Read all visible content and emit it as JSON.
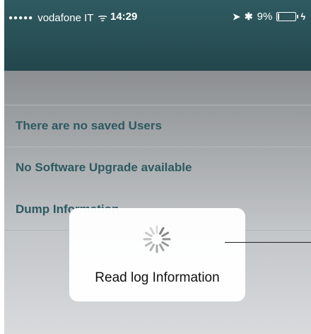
{
  "status_bar": {
    "signal": "●●●●●",
    "carrier": "vodafone IT",
    "wifi": "ᯤ",
    "time": "14:29",
    "location_icon": "➤",
    "bluetooth_icon": "✱",
    "battery": "9%",
    "battery_level": 0.09,
    "charging_icon": "ϟ"
  },
  "list": {
    "items": [
      {
        "label": "There are no saved Users"
      },
      {
        "label": "No Software Upgrade available"
      },
      {
        "label": "Dump Information"
      }
    ]
  },
  "hud": {
    "label": "Read log Information",
    "spinner_icon": "activity-indicator"
  },
  "colors": {
    "navbar": "#2f5a61",
    "list_text": "#2d5961",
    "background": "#c2c5c8"
  }
}
